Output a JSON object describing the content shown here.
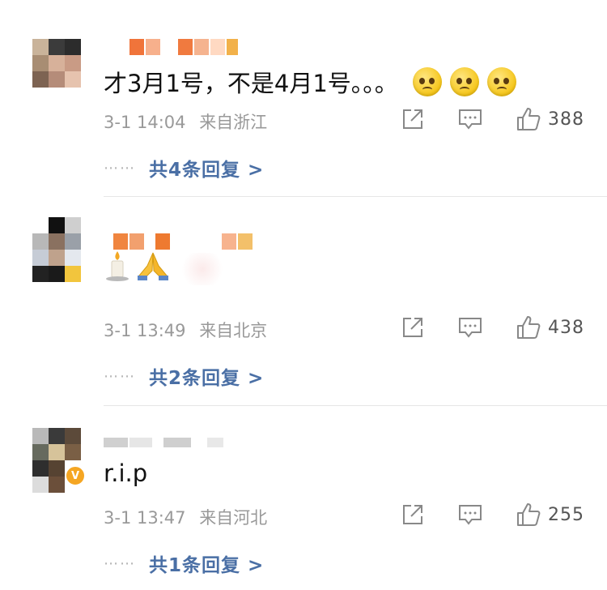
{
  "comments": [
    {
      "text": "才3月1号，不是4月1号。。。",
      "emojis": [
        "rolling-eyes-emoji",
        "rolling-eyes-emoji",
        "rolling-eyes-emoji"
      ],
      "time": "3-1 14:04",
      "source": "来自浙江",
      "likes": "388",
      "replies": "共4条回复 >"
    },
    {
      "text": "",
      "emojis": [
        "candle-emoji",
        "folded-hands-emoji"
      ],
      "time": "3-1 13:49",
      "source": "来自北京",
      "likes": "438",
      "replies": "共2条回复 >"
    },
    {
      "text": "r.i.p",
      "emojis": [],
      "time": "3-1 13:47",
      "source": "来自河北",
      "likes": "255",
      "replies": "共1条回复 >"
    }
  ],
  "dots": "⋯⋯",
  "verified_badge": "V",
  "colors": {
    "reply_link": "#4a6fa5",
    "meta": "#999999",
    "badge": "#f5a623"
  }
}
